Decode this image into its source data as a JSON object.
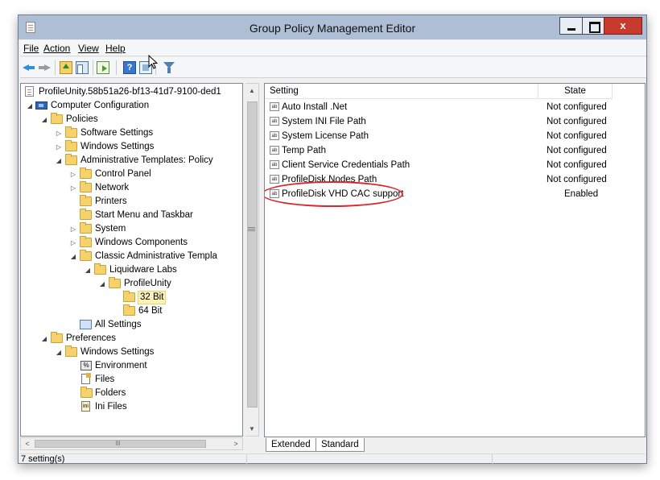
{
  "window": {
    "title": "Group Policy Management Editor",
    "close_glyph": "x"
  },
  "menu": {
    "items": [
      "File",
      "Action",
      "View",
      "Help"
    ]
  },
  "toolbar": {
    "icons": [
      "back-arrow-icon",
      "forward-arrow-icon",
      "up-folder-icon",
      "show-hide-console-tree-icon",
      "export-list-icon",
      "help-icon",
      "properties-icon",
      "filter-icon"
    ],
    "help_glyph": "?"
  },
  "tree": {
    "nodes": [
      {
        "label": "ProfileUnity.58b51a26-bf13-41d7-9100-ded1",
        "icon": "policy-document-icon",
        "expander": ""
      },
      {
        "label": "Computer Configuration",
        "icon": "computer-icon",
        "expander": "◢"
      },
      {
        "label": "Policies",
        "icon": "folder-icon",
        "expander": "◢"
      },
      {
        "label": "Software Settings",
        "icon": "folder-icon",
        "expander": "▷"
      },
      {
        "label": "Windows Settings",
        "icon": "folder-icon",
        "expander": "▷"
      },
      {
        "label": "Administrative Templates: Policy",
        "icon": "folder-icon",
        "expander": "◢"
      },
      {
        "label": "Control Panel",
        "icon": "folder-icon",
        "expander": "▷"
      },
      {
        "label": "Network",
        "icon": "folder-icon",
        "expander": "▷"
      },
      {
        "label": "Printers",
        "icon": "folder-icon",
        "expander": ""
      },
      {
        "label": "Start Menu and Taskbar",
        "icon": "folder-icon",
        "expander": ""
      },
      {
        "label": "System",
        "icon": "folder-icon",
        "expander": "▷"
      },
      {
        "label": "Windows Components",
        "icon": "folder-icon",
        "expander": "▷"
      },
      {
        "label": "Classic Administrative Templa",
        "icon": "folder-icon",
        "expander": "◢"
      },
      {
        "label": "Liquidware Labs",
        "icon": "folder-icon",
        "expander": "◢"
      },
      {
        "label": "ProfileUnity",
        "icon": "folder-icon",
        "expander": "◢"
      },
      {
        "label": "32 Bit",
        "icon": "folder-icon",
        "expander": "",
        "selected": true
      },
      {
        "label": "64 Bit",
        "icon": "folder-icon",
        "expander": ""
      },
      {
        "label": "All Settings",
        "icon": "all-settings-icon",
        "expander": ""
      },
      {
        "label": "Preferences",
        "icon": "folder-icon",
        "expander": "◢"
      },
      {
        "label": "Windows Settings",
        "icon": "folder-icon",
        "expander": "◢"
      },
      {
        "label": "Environment",
        "icon": "environment-icon",
        "expander": "",
        "icon_text": "%"
      },
      {
        "label": "Files",
        "icon": "files-icon",
        "expander": ""
      },
      {
        "label": "Folders",
        "icon": "folders-icon",
        "expander": ""
      },
      {
        "label": "Ini Files",
        "icon": "ini-file-icon",
        "expander": "",
        "icon_text": "ini"
      }
    ]
  },
  "scrollbars": {
    "up_glyph": "▲",
    "down_glyph": "▼",
    "left_glyph": "<",
    "right_glyph": ">"
  },
  "list": {
    "columns": [
      "Setting",
      "State"
    ],
    "rows": [
      {
        "setting": "Auto Install .Net",
        "state": "Not configured"
      },
      {
        "setting": "System INI File Path",
        "state": "Not configured"
      },
      {
        "setting": "System License Path",
        "state": "Not configured"
      },
      {
        "setting": "Temp Path",
        "state": "Not configured"
      },
      {
        "setting": "Client Service Credentials Path",
        "state": "Not configured"
      },
      {
        "setting": "ProfileDisk Nodes Path",
        "state": "Not configured"
      },
      {
        "setting": "ProfileDisk VHD CAC support",
        "state": "Enabled",
        "highlighted": true
      }
    ],
    "setting_icon_text": "ab"
  },
  "tabs": [
    "Extended",
    "Standard"
  ],
  "status": {
    "text": "7 setting(s)"
  },
  "colors": {
    "highlight_ellipse": "#d8282f",
    "title_bar": "#aebed4",
    "close_button": "#c83a2d"
  }
}
